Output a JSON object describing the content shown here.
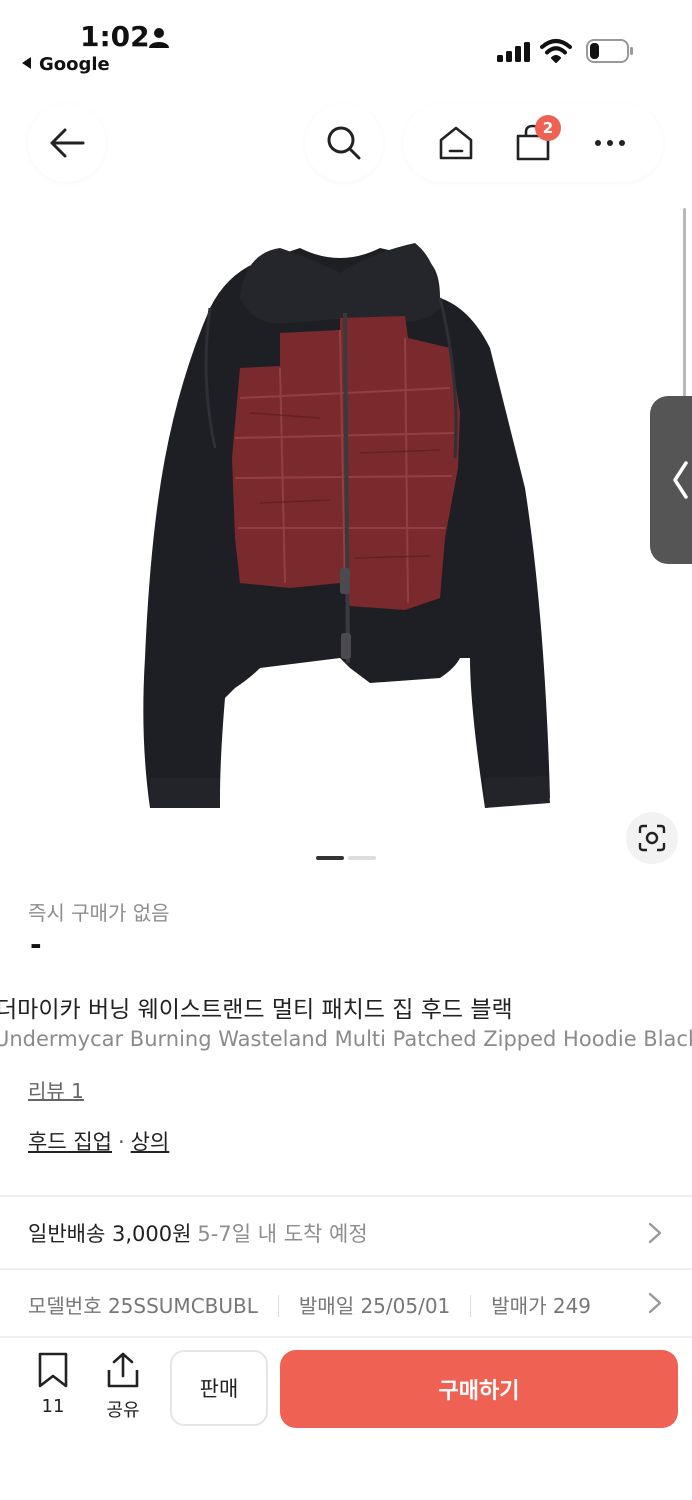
{
  "status_bar": {
    "time": "1:02",
    "back_app": "Google"
  },
  "nav": {
    "cart_count": "2"
  },
  "product": {
    "price_caption": "즉시 구매가 없음",
    "price": "-",
    "title_ko": "더마이카 버닝 웨이스트랜드 멀티 패치드 집 후드 블랙",
    "title_en": "Undermycar Burning Wasteland Multi Patched Zipped Hoodie Black",
    "review_link": "리뷰 1",
    "category_1": "후드 집업",
    "category_sep": "·",
    "category_2": "상의",
    "colors": {
      "hoodie": "#1e1f24",
      "patch": "#7a2a2c"
    }
  },
  "shipping": {
    "main": "일반배송 3,000원",
    "eta": "5-7일 내 도착 예정"
  },
  "specs": {
    "model": "모델번호 25SSUMCBUBL",
    "release_date": "발매일 25/05/01",
    "release_price": "발매가 249"
  },
  "bottom_bar": {
    "bookmark_count": "11",
    "share_label": "공유",
    "sell_label": "판매",
    "buy_label": "구매하기",
    "accent_color": "#ef6253"
  }
}
